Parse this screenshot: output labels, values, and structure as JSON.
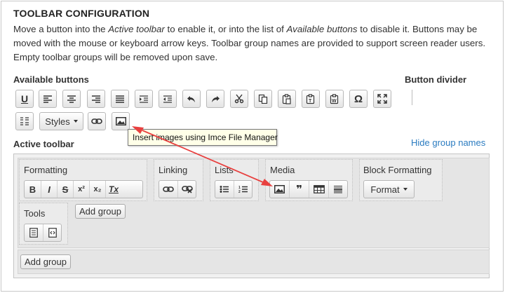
{
  "title": "TOOLBAR CONFIGURATION",
  "description": {
    "part1": "Move a button into the ",
    "em1": "Active toolbar",
    "part2": " to enable it, or into the list of ",
    "em2": "Available buttons",
    "part3": " to disable it. Buttons may be moved with the mouse or keyboard arrow keys. Toolbar group names are provided to support screen reader users. Empty toolbar groups will be removed upon save."
  },
  "available": {
    "label": "Available buttons",
    "buttons": [
      "underline",
      "justify-left",
      "justify-center",
      "justify-right",
      "justify-block",
      "indent",
      "outdent",
      "undo",
      "redo",
      "cut",
      "copy",
      "paste",
      "paste-text",
      "paste-from-word",
      "special-character",
      "maximize"
    ],
    "row2": [
      "show-blocks",
      "styles",
      "link",
      "image"
    ],
    "styles_label": "Styles"
  },
  "divider_label": "Button divider",
  "tooltip": "Insert images using Imce File Manager",
  "active": {
    "label": "Active toolbar",
    "hide_link": "Hide group names",
    "groups": {
      "formatting": {
        "name": "Formatting",
        "buttons": [
          "B",
          "I",
          "S",
          "x²",
          "x₂",
          "Tx"
        ]
      },
      "linking": {
        "name": "Linking"
      },
      "lists": {
        "name": "Lists"
      },
      "media": {
        "name": "Media",
        "quote": "❞"
      },
      "block": {
        "name": "Block Formatting",
        "format_label": "Format"
      },
      "tools": {
        "name": "Tools"
      }
    },
    "add_group_label": "Add group",
    "add_group_label2": "Add group"
  },
  "colors": {
    "link": "#2a7bc0",
    "arrow": "#e8403f"
  }
}
